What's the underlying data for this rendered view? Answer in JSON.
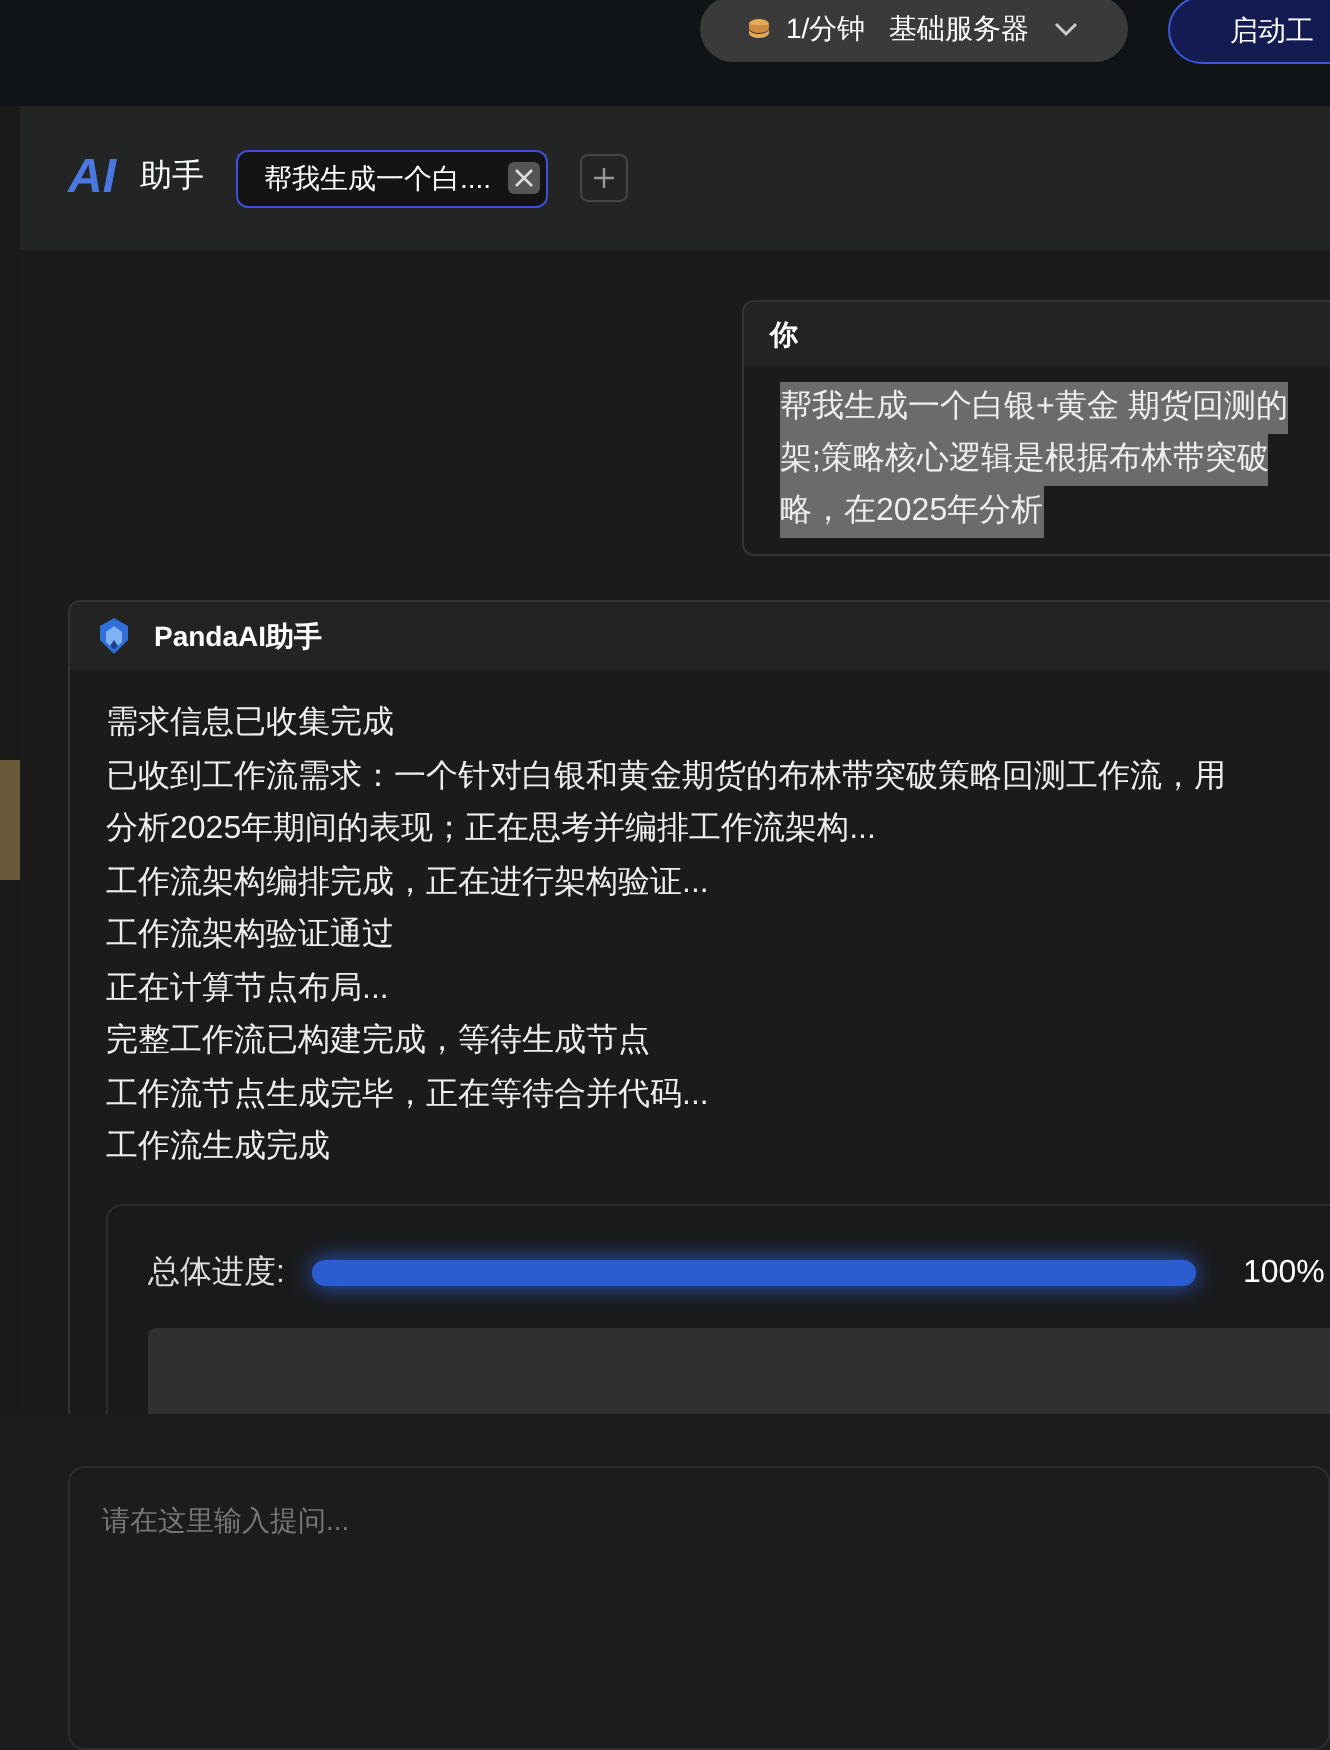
{
  "topbar": {
    "rate": "1/分钟",
    "server": "基础服务器",
    "start_button": "启动工"
  },
  "header": {
    "logo": "AI",
    "title": "助手",
    "tabs": [
      {
        "label": "帮我生成一个白....",
        "selected": true
      }
    ]
  },
  "user_message": {
    "author": "你",
    "lines": [
      "帮我生成一个白银+黄金 期货回测的",
      "架;策略核心逻辑是根据布林带突破",
      "略，在2025年分析"
    ]
  },
  "assistant_message": {
    "author": "PandaAI助手",
    "lines": [
      "需求信息已收集完成",
      "已收到工作流需求：一个针对白银和黄金期货的布林带突破策略回测工作流，用",
      "分析2025年期间的表现；正在思考并编排工作流架构...",
      "工作流架构编排完成，正在进行架构验证...",
      "工作流架构验证通过",
      "正在计算节点布局...",
      "完整工作流已构建完成，等待生成节点",
      "工作流节点生成完毕，正在等待合并代码...",
      "工作流生成完成"
    ],
    "progress": {
      "label": "总体进度:",
      "level": 1,
      "reading": "100%"
    }
  },
  "input": {
    "placeholder": "请在这里输入提问..."
  }
}
